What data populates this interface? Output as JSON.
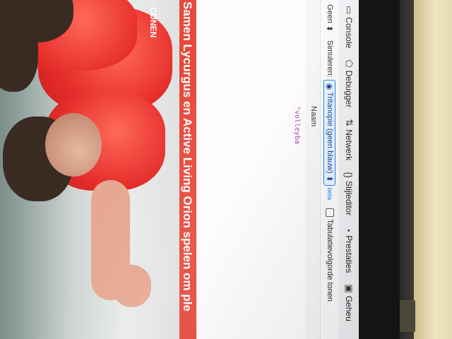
{
  "headline": "Samen Lycurgus en Active Living Orion spelen om ple",
  "jersey_text": "CONEN",
  "toolbar": {
    "tabs": [
      {
        "label": "Console",
        "icon": "console-icon"
      },
      {
        "label": "Debugger",
        "icon": "debugger-icon"
      },
      {
        "label": "Netwerk",
        "icon": "network-arrows-icon"
      },
      {
        "label": "Stijleditor",
        "icon": "braces-icon"
      },
      {
        "label": "Prestaties",
        "icon": "performance-gauge-icon"
      },
      {
        "label": "Geheu",
        "icon": "memory-icon"
      }
    ]
  },
  "accessibility_bar": {
    "filter_value": "Geen",
    "simulate_label": "Simuleren:",
    "simulate_value": "Tritanopie (geen blauw)",
    "beta_badge": "beta",
    "tab_order_label": "Tabulatievolgorde tonen"
  },
  "tree_header": {
    "name_column": "Naam"
  },
  "tree_snippet": "\"volleyba",
  "colors": {
    "accent": "#0a84ff",
    "headline_bg": "#e64a3c",
    "snippet": "#b03ab0"
  }
}
